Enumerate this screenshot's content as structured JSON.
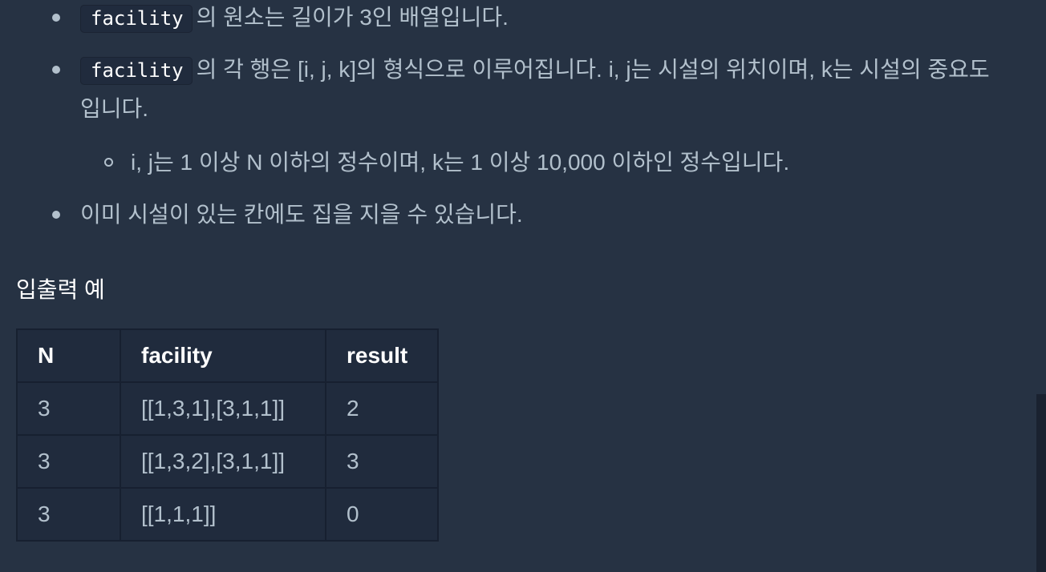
{
  "bullets": [
    {
      "code": "facility",
      "text": "의 원소는 길이가 3인 배열입니다."
    },
    {
      "code": "facility",
      "text": "의 각 행은 [i, j, k]의 형식으로 이루어집니다. i, j는 시설의 위치이며, k는 시설의 중요도입니다."
    },
    {
      "text": "이미 시설이 있는 칸에도 집을 지을 수 있습니다."
    }
  ],
  "sub_bullet": "i, j는 1 이상 N 이하의 정수이며, k는 1 이상 10,000 이하인 정수입니다.",
  "examples": {
    "heading": "입출력 예",
    "headers": [
      "N",
      "facility",
      "result"
    ],
    "rows": [
      [
        "3",
        "[[1,3,1],[3,1,1]]",
        "2"
      ],
      [
        "3",
        "[[1,3,2],[3,1,1]]",
        "3"
      ],
      [
        "3",
        "[[1,1,1]]",
        "0"
      ]
    ]
  }
}
